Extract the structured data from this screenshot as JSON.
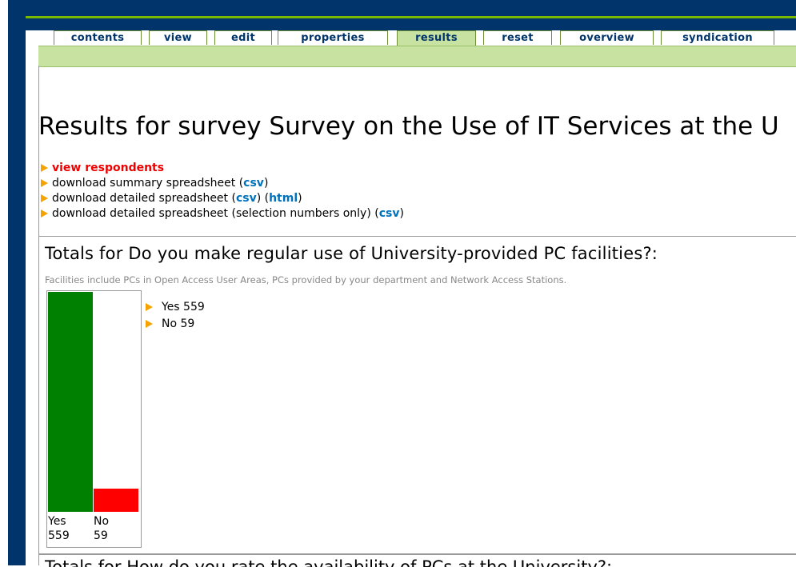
{
  "tabs": [
    {
      "label": "contents",
      "active": false
    },
    {
      "label": "view",
      "active": false
    },
    {
      "label": "edit",
      "active": false
    },
    {
      "label": "properties",
      "active": false
    },
    {
      "label": "results",
      "active": true
    },
    {
      "label": "reset",
      "active": false
    },
    {
      "label": "overview",
      "active": false
    },
    {
      "label": "syndication",
      "active": false
    }
  ],
  "page_title": "Results for survey Survey on the Use of IT Services at the U",
  "links": {
    "view_respondents": "view respondents",
    "summary_text": "download summary spreadsheet (",
    "summary_csv": "csv",
    "summary_close": ")",
    "detailed_text": "download detailed spreadsheet (",
    "detailed_csv": "csv",
    "detailed_mid": ") (",
    "detailed_html": "html",
    "detailed_close": ")",
    "selection_text": "download detailed spreadsheet (selection numbers only) (",
    "selection_csv": "csv",
    "selection_close": ")"
  },
  "section1": {
    "title": "Totals for Do you make regular use of University-provided PC facilities?:",
    "description": "Facilities include PCs in Open Access User Areas, PCs provided by your department and Network Access Stations.",
    "legend": [
      "Yes 559",
      "No 59"
    ]
  },
  "section2": {
    "title": "Totals for How do you rate the availability of PCs at the University?:"
  },
  "chart_data": {
    "type": "bar",
    "categories": [
      "Yes",
      "No"
    ],
    "values": [
      559,
      59
    ],
    "colors": [
      "#008000",
      "#ff0000"
    ]
  },
  "colors": {
    "navy": "#00346b",
    "accent_green": "#7ab800",
    "tab_active": "#c8e3a1",
    "link_blue": "#0072bc",
    "link_red": "#ee0000"
  },
  "icons": {
    "bullet": "orange-arrow-icon"
  }
}
